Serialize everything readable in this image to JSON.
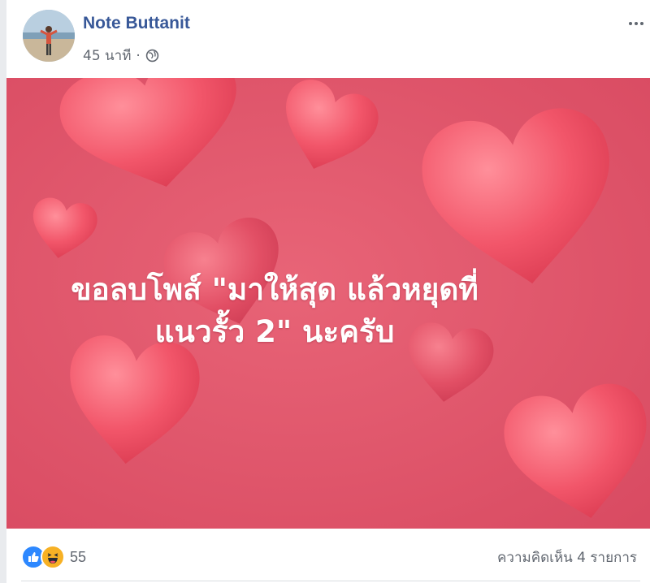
{
  "post": {
    "author": "Note Buttanit",
    "time": "45 นาที",
    "separator": "·",
    "audience_icon": "globe-icon",
    "more_icon": "more-options-icon",
    "image_text": {
      "line1": "ขอลบโพส์ \"มาให้สุด แล้วหยุดที่",
      "line2": "แนวรั้ว 2\" นะครับ"
    },
    "image_background": "#e05a6f",
    "reactions": [
      "like-reaction-icon",
      "haha-reaction-icon"
    ],
    "reaction_count": "55",
    "comments": "ความคิดเห็น 4 รายการ"
  },
  "colors": {
    "author_link": "#385898",
    "meta_text": "#616770",
    "like_blue": "#2d88ff",
    "haha_yellow": "#f7b125"
  }
}
